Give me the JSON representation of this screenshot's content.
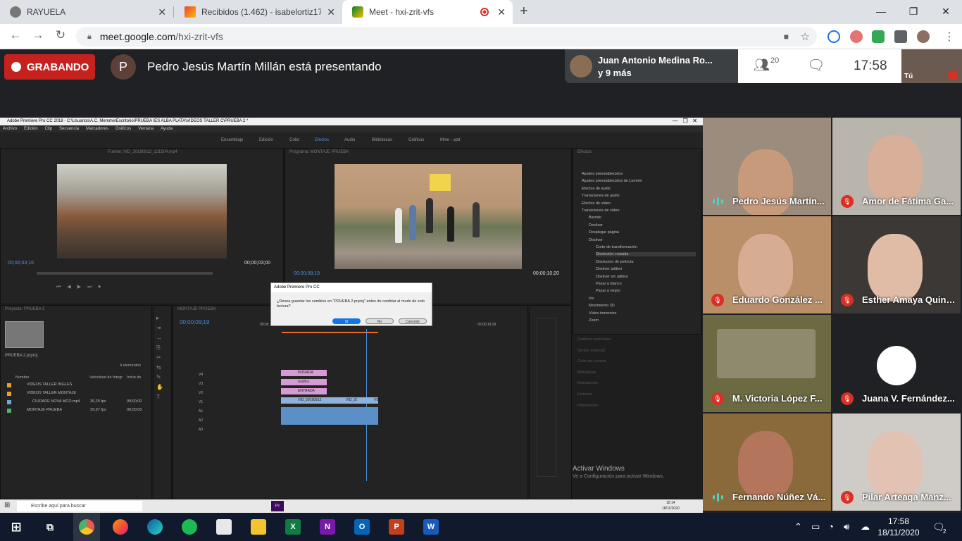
{
  "browser": {
    "tabs": [
      {
        "title": "RAYUELA",
        "icon": "globe-icon"
      },
      {
        "title": "Recibidos (1.462) - isabelortiz17@",
        "icon": "gmail-icon"
      },
      {
        "title": "Meet - hxi-zrit-vfs",
        "icon": "meet-icon",
        "active": true
      }
    ],
    "new_tab": "+",
    "url_domain": "meet.google.com",
    "url_path": "/hxi-zrit-vfs",
    "window_buttons": [
      "—",
      "❐",
      "✕"
    ]
  },
  "meet": {
    "recording_label": "GRABANDO",
    "presenter_initial": "P",
    "presenting_text": "Pedro Jesús Martín Millán está presentando",
    "chip_line1": "Juan Antonio Medina Ro...",
    "chip_line2": "y 9 más",
    "participants_count": "20",
    "time": "17:58",
    "self_label": "Tú",
    "tiles": [
      {
        "name": "Pedro Jesús Martín...",
        "muted": false,
        "bg": "#9b8c7d",
        "face": "#c79a7c"
      },
      {
        "name": "Amor de Fátima Ga...",
        "muted": true,
        "bg": "#b9b4ac",
        "face": "#d8b09a"
      },
      {
        "name": "Eduardo González ...",
        "muted": true,
        "bg": "#b98f6a",
        "face": "#d6ad92"
      },
      {
        "name": "Esther Amaya Quint...",
        "muted": true,
        "bg": "#3c3835",
        "face": "#e0bba6"
      },
      {
        "name": "M. Victoria López F...",
        "muted": true,
        "bg": "#6c6a43",
        "face": "#6c6a43"
      },
      {
        "name": "Juana V. Fernández...",
        "muted": true,
        "bg": "#202124",
        "face": "#ffffff"
      },
      {
        "name": "Fernando Núñez Vá...",
        "muted": false,
        "bg": "#8a6a3a",
        "face": "#b3765c"
      },
      {
        "name": "Pilar Arteaga Manz...",
        "muted": true,
        "bg": "#cfccc8",
        "face": "#e1c2b3"
      }
    ]
  },
  "premiere": {
    "title": "Adobe Premiere Pro CC 2018 - C:\\Usuarios\\A.C. Memme\\Escritorio\\PRUEBA IES ALBA PLATA\\VIDEOS TALLER C\\PRUEBA 2 *",
    "menu": [
      "Archivo",
      "Edición",
      "Clip",
      "Secuencia",
      "Marcadores",
      "Gráficos",
      "Ventana",
      "Ayuda"
    ],
    "workspaces": [
      "Ensamblaje",
      "Edición",
      "Color",
      "Efectos",
      "Audio",
      "Bibliotecas",
      "Gráficos",
      "Mine - upd"
    ],
    "source_tab": "Fuente: VID_20190912_121504.mp4",
    "program_tab": "Programa: MONTAJE PRUEBA",
    "source_tc_left": "00;00;03;16",
    "source_tc_right": "00;00;03;00",
    "program_tc_left": "00;00;08;19",
    "program_tc_right": "00;00;10;20",
    "timeline_tc": "00;00;09;19",
    "timeline_tab": "MONTAJE PRUEBA",
    "ruler_marks": [
      "00;00",
      "00;00;19;29"
    ],
    "project_tab": "Proyecto: PRUEBA 2",
    "project_file": "PRUEBA 2.prproj",
    "project_count": "4 elementos",
    "project_cols": [
      "Nombre",
      "Velocidad de fotogr",
      "Inicio de"
    ],
    "project_items": [
      {
        "name": "VIDEOS TALLER INGLES",
        "fps": "",
        "start": ""
      },
      {
        "name": "VIDEOS TALLER MONTAJE",
        "fps": "",
        "start": ""
      },
      {
        "name": "CIUDADE NOVA MCO.mp4",
        "fps": "30,25 fps",
        "start": "00;00;00"
      },
      {
        "name": "MONTAJE PRUEBA",
        "fps": "29,97 fps",
        "start": "00;00;00"
      }
    ],
    "tracks": [
      "V4",
      "V3",
      "V2",
      "V1",
      "A1",
      "A2",
      "A3"
    ],
    "clips": [
      "INTRADA",
      "Gráfico",
      "ENTRADA",
      "VID_20190912",
      "VID_20190",
      "VID_20"
    ],
    "effects_title": "Efectos",
    "effects": [
      "Ajustes preestablecidos",
      "Ajustes preestablecidos de Lumetri",
      "Efectos de audio",
      "Transiciones de audio",
      "Efectos de vídeo",
      "Transiciones de vídeo",
      "Barrido",
      "Deslizar",
      "Desplegar página",
      "Disolver",
      "Corte de transformación",
      "Disolución cruzada",
      "Disolución de película",
      "Disolver aditivo",
      "Disolver sin aditivo",
      "Pasar a blanco",
      "Pasar a negro",
      "Iris",
      "Movimiento 3D",
      "Vídeo inmersivo",
      "Zoom"
    ],
    "side_panels": [
      "Gráficos esenciales",
      "Sonido esencial",
      "Color de Lumetri",
      "Bibliotecas",
      "Marcadores",
      "Historial",
      "Información"
    ],
    "dialog_title": "Adobe Premiere Pro CC",
    "dialog_message": "¿Desea guardar los cambios en \"PRUEBA 2.prproj\" antes de cambiar al modo de solo lectura?",
    "dialog_buttons": [
      "Sí",
      "No",
      "Cancelar"
    ],
    "activate_title": "Activar Windows",
    "activate_sub": "Ve a Configuración para activar Windows.",
    "inner_search": "Escribe aquí para buscar",
    "inner_time": "18:14",
    "inner_date": "18/11/2020"
  },
  "taskbar": {
    "time": "17:58",
    "date": "18/11/2020",
    "notifications": "2",
    "apps": [
      "windows-start-icon",
      "task-view-icon",
      "chrome-icon",
      "firefox-icon",
      "edge-icon",
      "spotify-icon",
      "store-icon",
      "sticky-notes-icon",
      "excel-icon",
      "onenote-icon",
      "outlook-icon",
      "powerpoint-icon",
      "word-icon"
    ]
  }
}
